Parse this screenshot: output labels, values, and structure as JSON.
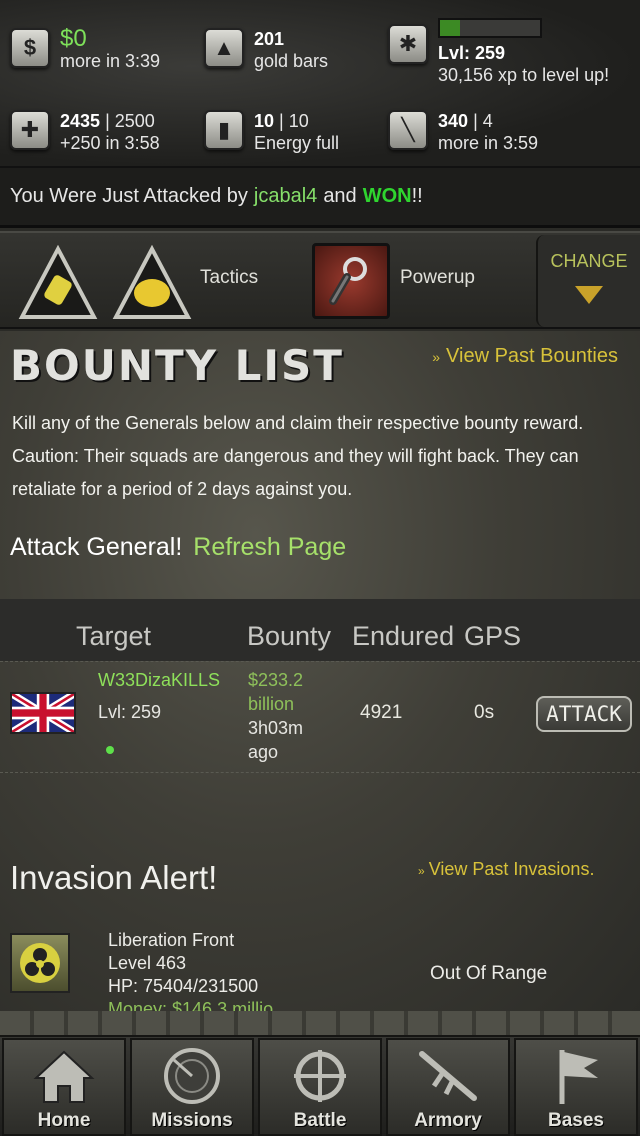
{
  "stats": {
    "cash": {
      "value": "$0",
      "sub": "more in 3:39",
      "icon": "dollar-icon"
    },
    "gold": {
      "value": "201",
      "sub": "gold bars",
      "icon": "gold-icon"
    },
    "level": {
      "value": "Lvl: 259",
      "sub": "30,156 xp to level up!",
      "icon": "badge-icon",
      "xp_fraction": 0.2
    },
    "health": {
      "value": "2435",
      "max": "| 2500",
      "sub": "+250 in 3:58",
      "icon": "health-icon"
    },
    "energy": {
      "value": "10",
      "max": "| 10",
      "sub": "Energy full",
      "icon": "energy-icon"
    },
    "stamina": {
      "value": "340",
      "max": "| 4",
      "sub": "more in 3:59",
      "icon": "stamina-icon"
    }
  },
  "notice": {
    "prefix": "You Were Just Attacked by",
    "attacker": "jcabal4",
    "mid": "and",
    "result": "WON",
    "suffix": "!!"
  },
  "tactics": {
    "tactics_label": "Tactics",
    "powerup_label": "Powerup",
    "change_label": "CHANGE"
  },
  "bounty": {
    "title": "BOUNTY LIST",
    "past_link": "View Past Bounties",
    "description": "Kill any of the Generals below and claim their respective bounty reward. Caution: Their squads are dangerous and they will fight back. They can retaliate for a period of 2 days against you.",
    "attack_general": "Attack General!",
    "refresh": "Refresh Page",
    "columns": {
      "target": "Target",
      "bounty": "Bounty",
      "endured": "Endured",
      "gps": "GPS"
    },
    "rows": [
      {
        "name": "W33DizaKILLS",
        "level": "Lvl: 259",
        "amount_line1": "$233.2",
        "amount_line2": "billion",
        "ago_line1": "3h03m",
        "ago_line2": "ago",
        "endured": "4921",
        "gps": "0s",
        "action": "ATTACK"
      }
    ]
  },
  "invasion": {
    "title": "Invasion Alert!",
    "past_link": "View Past Invasions.",
    "name": "Liberation Front",
    "level": "Level 463",
    "hp": "HP: 75404/231500",
    "money": "Money: $146.3 millio",
    "status": "Out Of Range"
  },
  "nav": [
    {
      "label": "Home",
      "icon": "home-icon"
    },
    {
      "label": "Missions",
      "icon": "radar-icon"
    },
    {
      "label": "Battle",
      "icon": "crosshair-icon"
    },
    {
      "label": "Armory",
      "icon": "rifle-icon"
    },
    {
      "label": "Bases",
      "icon": "flag-icon"
    }
  ]
}
